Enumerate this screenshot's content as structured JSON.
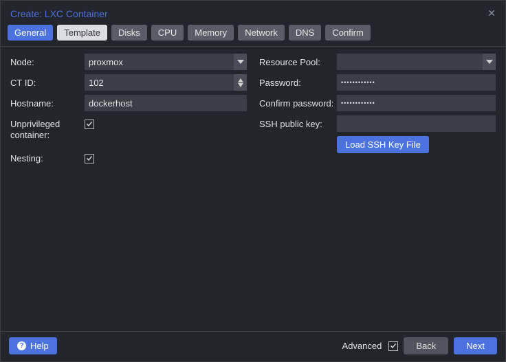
{
  "dialog": {
    "title": "Create: LXC Container"
  },
  "tabs": {
    "general": "General",
    "template": "Template",
    "disks": "Disks",
    "cpu": "CPU",
    "memory": "Memory",
    "network": "Network",
    "dns": "DNS",
    "confirm": "Confirm"
  },
  "left": {
    "node_label": "Node:",
    "node_value": "proxmox",
    "ctid_label": "CT ID:",
    "ctid_value": "102",
    "hostname_label": "Hostname:",
    "hostname_value": "dockerhost",
    "unpriv_label": "Unprivileged container:",
    "nesting_label": "Nesting:"
  },
  "right": {
    "pool_label": "Resource Pool:",
    "pool_value": "",
    "password_label": "Password:",
    "password_mask": "••••••••••••",
    "confirm_label": "Confirm password:",
    "confirm_mask": "••••••••••••",
    "sshkey_label": "SSH public key:",
    "sshkey_value": "",
    "load_key_btn": "Load SSH Key File"
  },
  "footer": {
    "help": "Help",
    "advanced": "Advanced",
    "back": "Back",
    "next": "Next"
  }
}
